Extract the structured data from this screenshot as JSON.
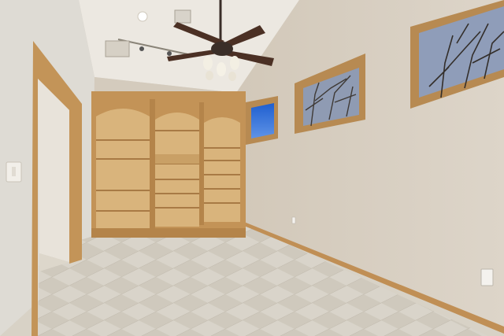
{
  "scene": {
    "subject": "interior-room",
    "palette": {
      "wall_right": "#d9d0c3",
      "wall_left": "#dedad3",
      "wall_back": "#d4cabb",
      "ceiling": "#ebe7df",
      "wood": "#c59a62",
      "wood_dark": "#a87a45",
      "shelf_back": "#d8b27b",
      "floor": "#d6d1c6",
      "sky": "#2b6fd6"
    }
  }
}
